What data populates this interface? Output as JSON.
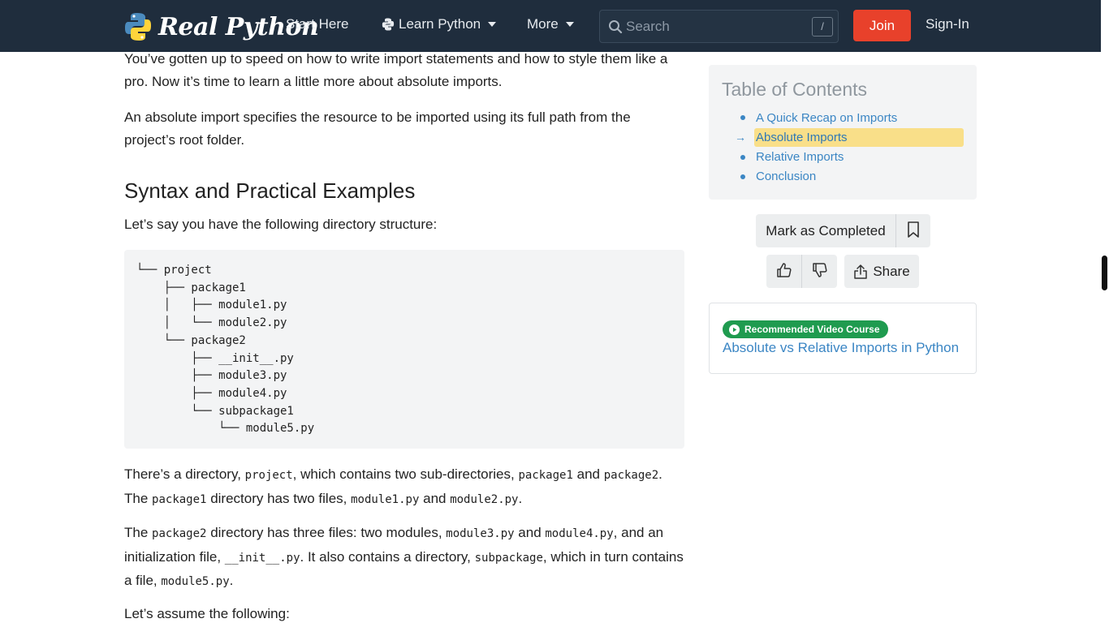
{
  "navbar": {
    "logo_text": "Real Python",
    "start_here": "Start Here",
    "learn_python": "Learn Python",
    "more": "More",
    "search_placeholder": "Search",
    "search_shortcut": "/",
    "join": "Join",
    "sign_in": "Sign-In"
  },
  "article": {
    "p1": "You’ve gotten up to speed on how to write import statements and how to style them like a pro. Now it’s time to learn a little more about absolute imports.",
    "p2": "An absolute import specifies the resource to be imported using its full path from the project’s root folder.",
    "h2": "Syntax and Practical Examples",
    "p3": "Let’s say you have the following directory structure:",
    "code": "└── project\n    ├── package1\n    │   ├── module1.py\n    │   └── module2.py\n    └── package2\n        ├── __init__.py\n        ├── module3.py\n        ├── module4.py\n        └── subpackage1\n            └── module5.py",
    "p4": {
      "t1": "There’s a directory, ",
      "c1": "project",
      "t2": ", which contains two sub-directories, ",
      "c2": "package1",
      "t3": " and ",
      "c3": "package2",
      "t4": ". The ",
      "c4": "package1",
      "t5": " directory has two files, ",
      "c5": "module1.py",
      "t6": " and ",
      "c6": "module2.py",
      "t7": "."
    },
    "p5": {
      "t1": "The ",
      "c1": "package2",
      "t2": " directory has three files: two modules, ",
      "c2": "module3.py",
      "t3": " and ",
      "c3": "module4.py",
      "t4": ", and an initialization file, ",
      "c4": "__init__.py",
      "t5": ". It also contains a directory, ",
      "c5": "subpackage",
      "t6": ", which in turn contains a file, ",
      "c6": "module5.py",
      "t7": "."
    },
    "p6": "Let’s assume the following:"
  },
  "toc": {
    "title": "Table of Contents",
    "items": [
      {
        "label": "A Quick Recap on Imports",
        "active": false
      },
      {
        "label": "Absolute Imports",
        "active": true
      },
      {
        "label": "Relative Imports",
        "active": false
      },
      {
        "label": "Conclusion",
        "active": false
      }
    ],
    "active_marker": "→"
  },
  "actions": {
    "mark_completed": "Mark as Completed",
    "share": "Share"
  },
  "recommended": {
    "badge": "Recommended Video Course",
    "link": "Absolute vs Relative Imports in Python"
  },
  "colors": {
    "navbar_bg": "#1f2d3d",
    "join_bg": "#e8412b",
    "link": "#3b86c4",
    "toc_highlight": "#f9df89",
    "badge_green": "#1f9b4f"
  },
  "icons": {
    "logo": "python-logo-icon",
    "learn": "python-logo-icon",
    "search": "search-icon",
    "bookmark": "bookmark-icon",
    "like": "thumbs-up-icon",
    "dislike": "thumbs-down-icon",
    "share": "share-icon",
    "play": "play-circle-icon"
  }
}
